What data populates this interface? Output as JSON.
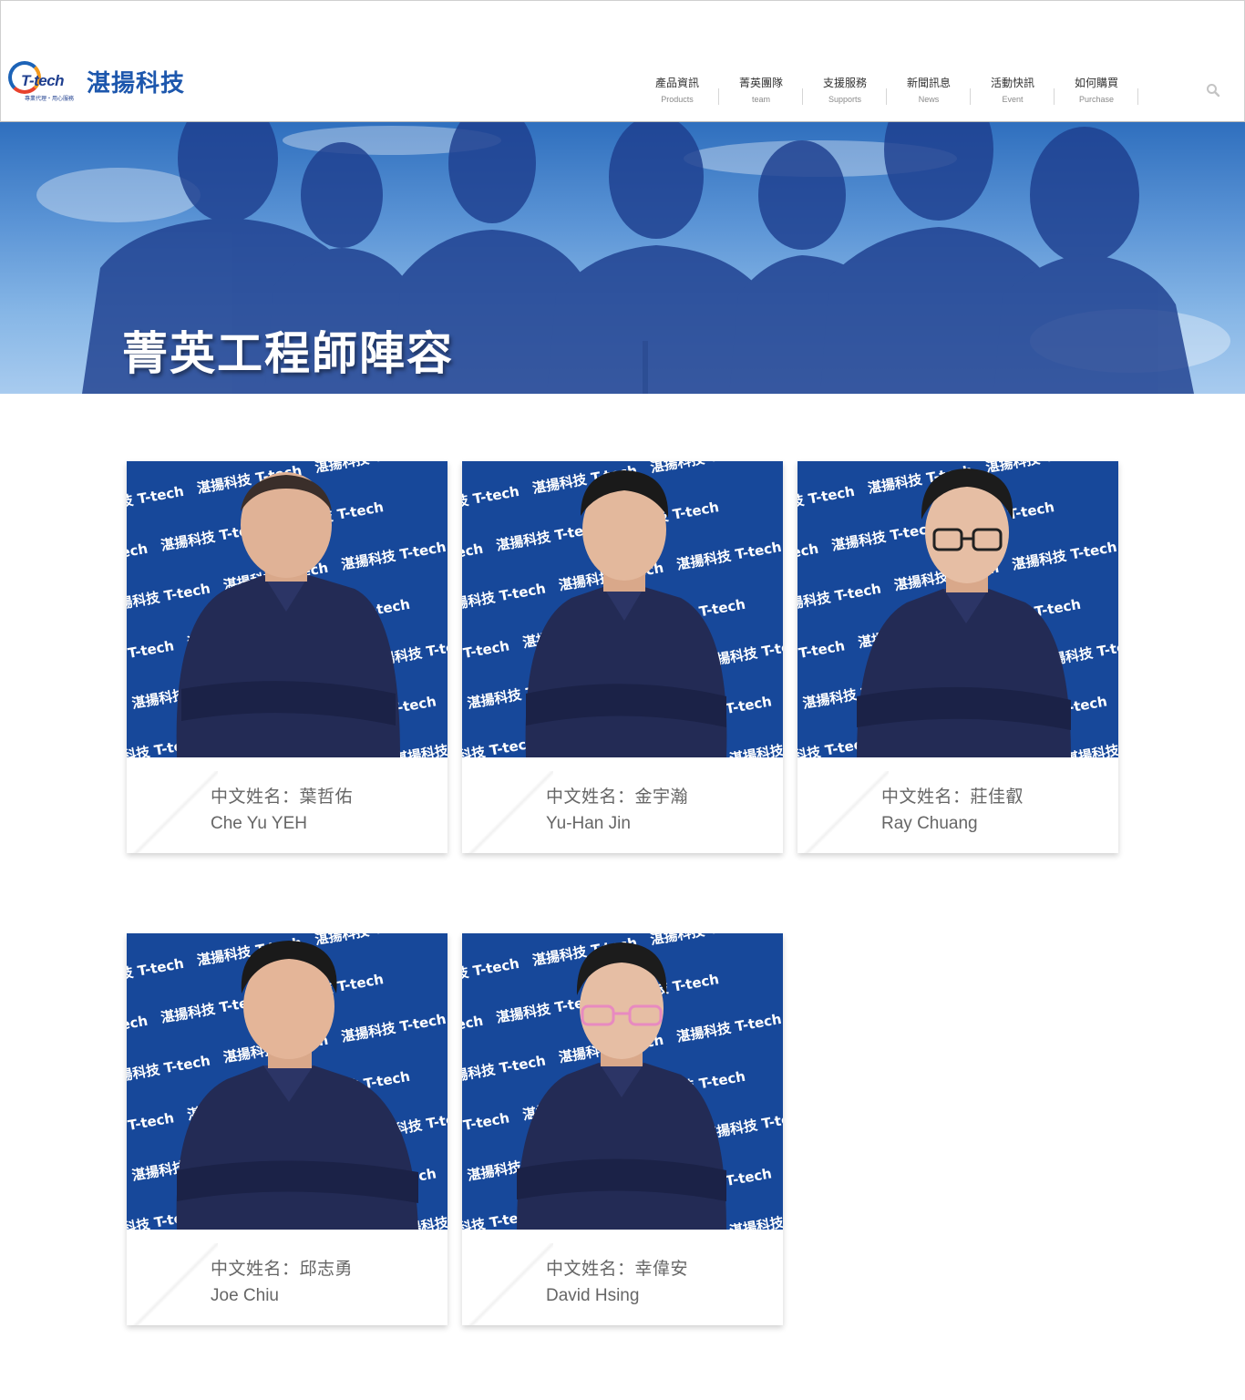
{
  "brand": {
    "logo_word": "T-tech",
    "logo_tagline": "專業代理・用心服務",
    "name": "湛揚科技"
  },
  "nav": [
    {
      "zh": "產品資訊",
      "en": "Products"
    },
    {
      "zh": "菁英團隊",
      "en": "team"
    },
    {
      "zh": "支援服務",
      "en": "Supports"
    },
    {
      "zh": "新聞訊息",
      "en": "News"
    },
    {
      "zh": "活動快訊",
      "en": "Event"
    },
    {
      "zh": "如何購買",
      "en": "Purchase"
    }
  ],
  "banner": {
    "title": "菁英工程師陣容"
  },
  "team": [
    {
      "zh_name": "中文姓名：葉哲佑",
      "en_name": "Che Yu YEH"
    },
    {
      "zh_name": "中文姓名：金宇瀚",
      "en_name": "Yu-Han Jin"
    },
    {
      "zh_name": "中文姓名：莊佳叡",
      "en_name": "Ray Chuang"
    },
    {
      "zh_name": "中文姓名：邱志勇",
      "en_name": "Joe Chiu"
    },
    {
      "zh_name": "中文姓名：幸偉安",
      "en_name": "David Hsing"
    }
  ],
  "backdrop_text": "湛揚科技 T-tech",
  "colors": {
    "brand_blue": "#1d57ad",
    "backdrop_blue": "#17489a",
    "shirt_navy": "#232b55"
  }
}
